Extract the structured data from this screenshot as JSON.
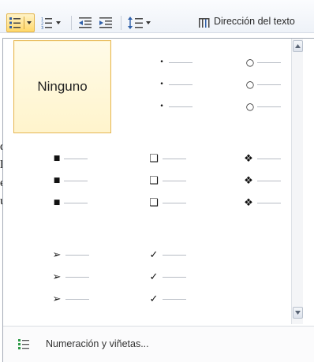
{
  "toolbar": {
    "text_direction_label": "Dirección del texto"
  },
  "gallery": {
    "none_label": "Ninguno"
  },
  "footer": {
    "numbering_label": "Numeración y viñetas..."
  },
  "colors": {
    "selected_fill": "#fff4cc",
    "selected_border": "#e6b64f",
    "accent_green": "#2e9b47",
    "icon_blue": "#2f5fa8"
  }
}
